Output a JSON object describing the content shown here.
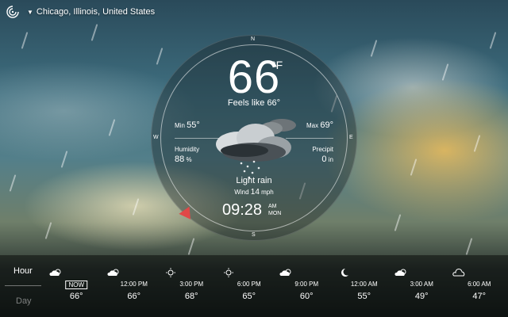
{
  "location": {
    "name": "Chicago, Illinois, United States"
  },
  "compass": {
    "n": "N",
    "s": "S",
    "e": "E",
    "w": "W"
  },
  "current": {
    "temperature": "66",
    "unit": "°F",
    "feels_like": "Feels like 66°",
    "min_label": "Min",
    "min_value": "55°",
    "max_label": "Max",
    "max_value": "69°",
    "humidity_label": "Humidity",
    "humidity_value": "88",
    "humidity_unit": "%",
    "precip_label": "Precipit",
    "precip_value": "0",
    "precip_unit": "in",
    "condition": "Light rain",
    "wind_label": "Wind",
    "wind_value": "14",
    "wind_unit": "mph",
    "time": "09:28",
    "ampm": "AM",
    "day": "MON"
  },
  "tabs": {
    "hour": "Hour",
    "day": "Day"
  },
  "hourly": [
    {
      "time": "NOW",
      "temp": "66°",
      "icon": "partly-cloudy-day-icon"
    },
    {
      "time": "12:00 PM",
      "temp": "66°",
      "icon": "partly-cloudy-day-icon"
    },
    {
      "time": "3:00 PM",
      "temp": "68°",
      "icon": "sun-icon"
    },
    {
      "time": "6:00 PM",
      "temp": "65°",
      "icon": "sun-icon"
    },
    {
      "time": "9:00 PM",
      "temp": "60°",
      "icon": "partly-cloudy-day-icon"
    },
    {
      "time": "12:00 AM",
      "temp": "55°",
      "icon": "moon-icon"
    },
    {
      "time": "3:00 AM",
      "temp": "49°",
      "icon": "partly-cloudy-day-icon"
    },
    {
      "time": "6:00 AM",
      "temp": "47°",
      "icon": "cloud-icon"
    }
  ],
  "colors": {
    "marker": "#e04848"
  }
}
